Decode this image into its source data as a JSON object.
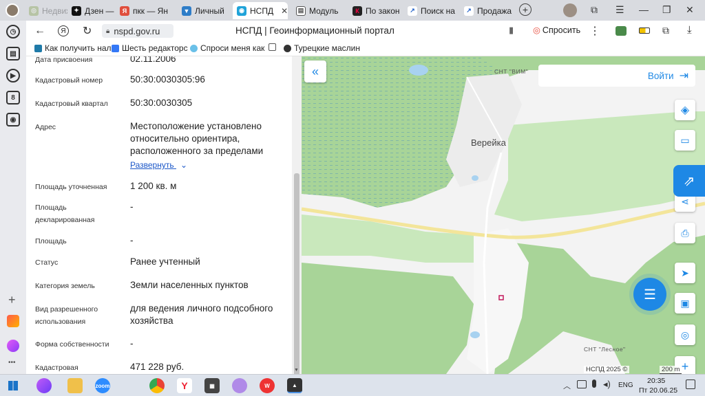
{
  "browser": {
    "tabs": [
      {
        "label": "Недвижимость",
        "active": false
      },
      {
        "label": "Дзен — ",
        "active": false
      },
      {
        "label": "пкк — Ян",
        "active": false
      },
      {
        "label": "Личный ",
        "active": false
      },
      {
        "label": "НСПД",
        "active": true
      },
      {
        "label": "Модуль ",
        "active": false
      },
      {
        "label": "По закон",
        "active": false
      },
      {
        "label": "Поиск на",
        "active": false
      },
      {
        "label": "Продажа",
        "active": false
      }
    ],
    "url": "nspd.gov.ru",
    "page_title": "НСПД | Геоинформационный портал",
    "ask_label": "Спросить",
    "bookmarks": [
      "Как получить нал",
      "Шесть редакторс",
      "Спроси меня как",
      "Турецкие маслин"
    ],
    "sidebar_badge": "8"
  },
  "panel": {
    "expand_label": "Развернуть",
    "fields": [
      {
        "label": "Дата присвоения",
        "value": "02.11.2006"
      },
      {
        "label": "Кадастровый номер",
        "value": "50:30:0030305:96"
      },
      {
        "label": "Кадастровый квартал",
        "value": "50:30:0030305"
      },
      {
        "label": "Адрес",
        "value": "Местоположение установлено относительно ориентира, расположенного за пределами"
      },
      {
        "label": "Площадь уточненная",
        "value": "1 200 кв. м"
      },
      {
        "label": "Площадь декларированная",
        "value": "-"
      },
      {
        "label": "Площадь",
        "value": "-"
      },
      {
        "label": "Статус",
        "value": "Ранее учтенный"
      },
      {
        "label": "Категория земель",
        "value": "Земли населенных пунктов"
      },
      {
        "label": "Вид разрешенного использования",
        "value": "для ведения личного подсобного хозяйства"
      },
      {
        "label": "Форма собственности",
        "value": "-"
      },
      {
        "label": "Кадастровая",
        "value": "471 228 руб."
      }
    ]
  },
  "map": {
    "login_label": "Войти",
    "village_label": "Верейка",
    "snt_vim_label": "СНТ \"ВИМ\"",
    "snt_lesnoe_label": "СНТ \"Лесное\"",
    "attribution": "НСПД 2025 ©",
    "scale_label": "200 m"
  },
  "taskbar": {
    "lang": "ENG",
    "time": "20:35",
    "date": "Пт 20.06.25"
  },
  "colors": {
    "forest": "#a8d498",
    "meadow": "#c9e8bc",
    "road": "#f3e59a",
    "water": "#a8d2f0",
    "accent": "#1e88e5"
  }
}
